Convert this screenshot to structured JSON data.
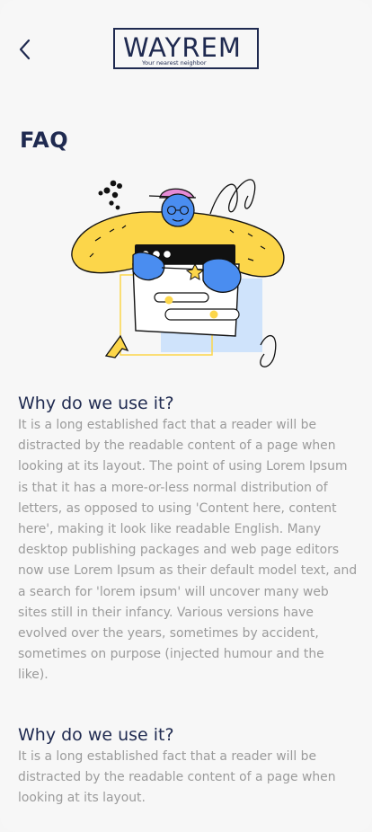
{
  "header": {
    "logo_text": "WAYREM",
    "logo_tagline": "Your nearest neighbor",
    "back_icon": "chevron-left-icon"
  },
  "page": {
    "title": "FAQ"
  },
  "faq": [
    {
      "question": "Why do we use it?",
      "answer": "It is a long established fact that a reader will be distracted by the readable content of a page when looking at its layout. The point of using Lorem Ipsum is that it has a more-or-less normal distribution of letters, as opposed to using 'Content here, content here', making it look like readable English. Many desktop publishing packages and web page editors now use Lorem Ipsum as their default model text, and a search for 'lorem ipsum' will uncover many web sites still in their infancy. Various versions have evolved over the years, sometimes by accident, sometimes on purpose (injected humour and the like)."
    },
    {
      "question": "Why do we use it?",
      "answer": "It is a long established fact that a reader will be distracted by the readable content of a page when looking at its layout."
    }
  ],
  "colors": {
    "navy": "#1f2a50",
    "body_text": "#9b9b9b",
    "yellow": "#fcd64a",
    "blue": "#4a8df0",
    "light_blue": "#cfe3fb",
    "pink": "#e58bd6"
  }
}
